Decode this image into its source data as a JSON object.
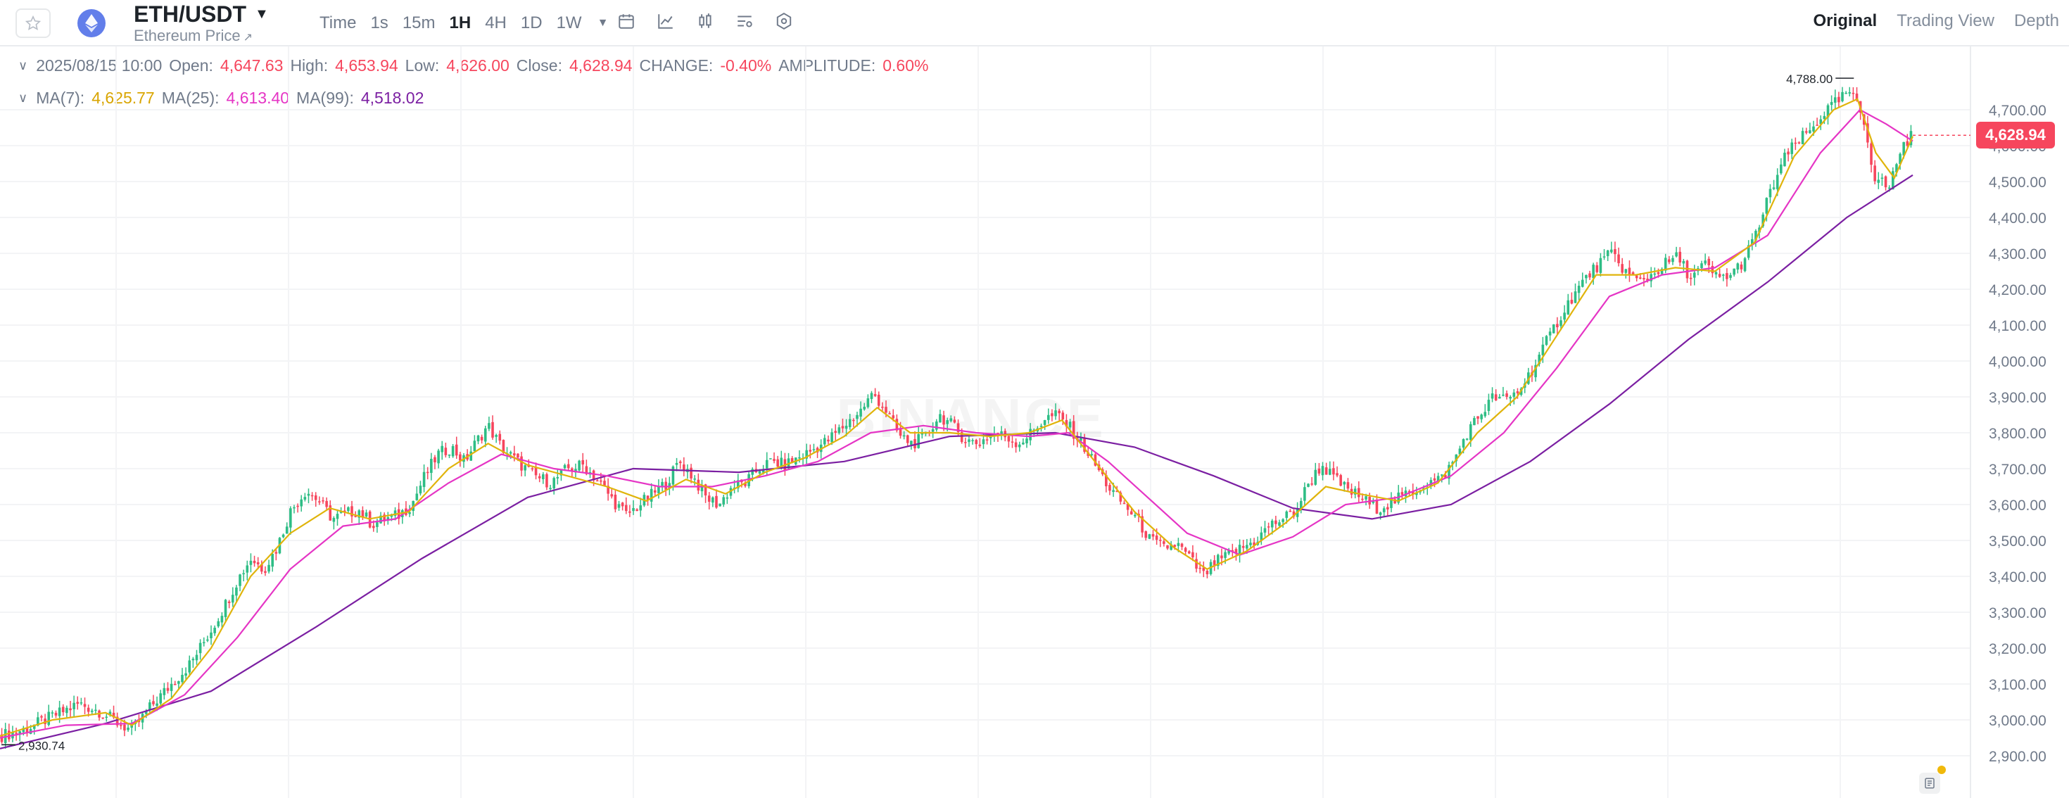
{
  "header": {
    "pair": "ETH/USDT",
    "subtitle": "Ethereum Price",
    "subtitle_arrow": "↗",
    "intervals": [
      {
        "label": "Time",
        "active": false
      },
      {
        "label": "1s",
        "active": false
      },
      {
        "label": "15m",
        "active": false
      },
      {
        "label": "1H",
        "active": true
      },
      {
        "label": "4H",
        "active": false
      },
      {
        "label": "1D",
        "active": false
      },
      {
        "label": "1W",
        "active": false
      }
    ],
    "views": [
      {
        "label": "Original",
        "active": true
      },
      {
        "label": "Trading View",
        "active": false
      },
      {
        "label": "Depth",
        "active": false
      }
    ]
  },
  "ohlc": {
    "datetime": "2025/08/15 10:00",
    "open_label": "Open:",
    "open": "4,647.63",
    "high_label": "High:",
    "high": "4,653.94",
    "low_label": "Low:",
    "low": "4,626.00",
    "close_label": "Close:",
    "close": "4,628.94",
    "change_label": "CHANGE:",
    "change": "-0.40%",
    "amplitude_label": "AMPLITUDE:",
    "amplitude": "0.60%"
  },
  "ma": {
    "ma7_label": "MA(7):",
    "ma7": "4,625.77",
    "ma25_label": "MA(25):",
    "ma25": "4,613.40",
    "ma99_label": "MA(99):",
    "ma99": "4,518.02"
  },
  "chart_data": {
    "type": "candlestick",
    "y_ticks": [
      "4,700.00",
      "4,600.00",
      "4,500.00",
      "4,400.00",
      "4,300.00",
      "4,200.00",
      "4,100.00",
      "4,000.00",
      "3,900.00",
      "3,800.00",
      "3,700.00",
      "3,600.00",
      "3,500.00",
      "3,400.00",
      "3,300.00",
      "3,200.00",
      "3,100.00",
      "3,000.00",
      "2,900.00"
    ],
    "y_tick_values": [
      4700,
      4600,
      4500,
      4400,
      4300,
      4200,
      4100,
      4000,
      3900,
      3800,
      3700,
      3600,
      3500,
      3400,
      3300,
      3200,
      3100,
      3000,
      2900
    ],
    "ylim": [
      2850,
      4810
    ],
    "current_price_label": "4,628.94",
    "current_price": 4628.94,
    "max_label": "4,788.00",
    "max_value": 4788.0,
    "min_label": "2,930.74",
    "min_value": 2930.74,
    "watermark": "BINANCE",
    "close_path": [
      [
        0,
        2955
      ],
      [
        20,
        2975
      ],
      [
        40,
        3010
      ],
      [
        60,
        3045
      ],
      [
        75,
        3025
      ],
      [
        90,
        2990
      ],
      [
        100,
        2970
      ],
      [
        115,
        3040
      ],
      [
        130,
        3100
      ],
      [
        145,
        3160
      ],
      [
        160,
        3250
      ],
      [
        172,
        3330
      ],
      [
        180,
        3390
      ],
      [
        190,
        3450
      ],
      [
        200,
        3420
      ],
      [
        210,
        3480
      ],
      [
        220,
        3580
      ],
      [
        232,
        3640
      ],
      [
        242,
        3610
      ],
      [
        252,
        3560
      ],
      [
        262,
        3575
      ],
      [
        272,
        3585
      ],
      [
        282,
        3545
      ],
      [
        292,
        3560
      ],
      [
        302,
        3570
      ],
      [
        312,
        3600
      ],
      [
        322,
        3680
      ],
      [
        332,
        3740
      ],
      [
        342,
        3760
      ],
      [
        352,
        3720
      ],
      [
        362,
        3780
      ],
      [
        370,
        3820
      ],
      [
        380,
        3760
      ],
      [
        392,
        3720
      ],
      [
        405,
        3680
      ],
      [
        418,
        3660
      ],
      [
        430,
        3700
      ],
      [
        442,
        3710
      ],
      [
        455,
        3660
      ],
      [
        465,
        3610
      ],
      [
        475,
        3570
      ],
      [
        485,
        3600
      ],
      [
        495,
        3630
      ],
      [
        505,
        3660
      ],
      [
        515,
        3720
      ],
      [
        525,
        3680
      ],
      [
        535,
        3620
      ],
      [
        545,
        3600
      ],
      [
        555,
        3650
      ],
      [
        565,
        3660
      ],
      [
        575,
        3700
      ],
      [
        585,
        3720
      ],
      [
        595,
        3710
      ],
      [
        605,
        3730
      ],
      [
        615,
        3750
      ],
      [
        628,
        3780
      ],
      [
        640,
        3820
      ],
      [
        652,
        3860
      ],
      [
        662,
        3910
      ],
      [
        672,
        3860
      ],
      [
        682,
        3790
      ],
      [
        692,
        3770
      ],
      [
        702,
        3790
      ],
      [
        712,
        3850
      ],
      [
        722,
        3820
      ],
      [
        732,
        3780
      ],
      [
        742,
        3770
      ],
      [
        752,
        3800
      ],
      [
        762,
        3790
      ],
      [
        772,
        3770
      ],
      [
        782,
        3800
      ],
      [
        792,
        3840
      ],
      [
        802,
        3850
      ],
      [
        812,
        3810
      ],
      [
        822,
        3760
      ],
      [
        832,
        3700
      ],
      [
        842,
        3640
      ],
      [
        852,
        3600
      ],
      [
        862,
        3560
      ],
      [
        872,
        3500
      ],
      [
        882,
        3480
      ],
      [
        892,
        3490
      ],
      [
        902,
        3450
      ],
      [
        912,
        3400
      ],
      [
        922,
        3440
      ],
      [
        932,
        3460
      ],
      [
        942,
        3480
      ],
      [
        952,
        3500
      ],
      [
        962,
        3540
      ],
      [
        972,
        3560
      ],
      [
        982,
        3580
      ],
      [
        992,
        3660
      ],
      [
        1002,
        3710
      ],
      [
        1012,
        3670
      ],
      [
        1022,
        3640
      ],
      [
        1032,
        3620
      ],
      [
        1042,
        3590
      ],
      [
        1052,
        3600
      ],
      [
        1062,
        3620
      ],
      [
        1072,
        3640
      ],
      [
        1082,
        3660
      ],
      [
        1092,
        3670
      ],
      [
        1102,
        3720
      ],
      [
        1112,
        3800
      ],
      [
        1122,
        3850
      ],
      [
        1132,
        3900
      ],
      [
        1142,
        3890
      ],
      [
        1152,
        3920
      ],
      [
        1162,
        3980
      ],
      [
        1172,
        4050
      ],
      [
        1182,
        4120
      ],
      [
        1192,
        4180
      ],
      [
        1202,
        4230
      ],
      [
        1212,
        4270
      ],
      [
        1222,
        4300
      ],
      [
        1232,
        4250
      ],
      [
        1242,
        4220
      ],
      [
        1252,
        4240
      ],
      [
        1262,
        4270
      ],
      [
        1272,
        4290
      ],
      [
        1282,
        4230
      ],
      [
        1292,
        4270
      ],
      [
        1302,
        4230
      ],
      [
        1312,
        4240
      ],
      [
        1322,
        4280
      ],
      [
        1332,
        4360
      ],
      [
        1342,
        4470
      ],
      [
        1352,
        4560
      ],
      [
        1362,
        4610
      ],
      [
        1372,
        4640
      ],
      [
        1382,
        4690
      ],
      [
        1392,
        4720
      ],
      [
        1402,
        4750
      ],
      [
        1410,
        4700
      ],
      [
        1416,
        4620
      ],
      [
        1420,
        4520
      ],
      [
        1426,
        4500
      ],
      [
        1432,
        4480
      ],
      [
        1438,
        4560
      ],
      [
        1444,
        4610
      ],
      [
        1450,
        4630
      ]
    ],
    "ma7_path": [
      [
        0,
        2955
      ],
      [
        40,
        3000
      ],
      [
        80,
        3020
      ],
      [
        100,
        2985
      ],
      [
        130,
        3060
      ],
      [
        160,
        3200
      ],
      [
        190,
        3400
      ],
      [
        220,
        3520
      ],
      [
        250,
        3590
      ],
      [
        280,
        3560
      ],
      [
        310,
        3580
      ],
      [
        340,
        3700
      ],
      [
        370,
        3770
      ],
      [
        400,
        3710
      ],
      [
        430,
        3680
      ],
      [
        460,
        3650
      ],
      [
        490,
        3610
      ],
      [
        520,
        3670
      ],
      [
        550,
        3630
      ],
      [
        580,
        3690
      ],
      [
        610,
        3730
      ],
      [
        640,
        3790
      ],
      [
        665,
        3870
      ],
      [
        690,
        3800
      ],
      [
        720,
        3800
      ],
      [
        750,
        3790
      ],
      [
        780,
        3800
      ],
      [
        805,
        3835
      ],
      [
        830,
        3720
      ],
      [
        860,
        3580
      ],
      [
        890,
        3480
      ],
      [
        915,
        3420
      ],
      [
        945,
        3470
      ],
      [
        975,
        3550
      ],
      [
        1005,
        3650
      ],
      [
        1030,
        3630
      ],
      [
        1060,
        3610
      ],
      [
        1090,
        3660
      ],
      [
        1120,
        3800
      ],
      [
        1150,
        3900
      ],
      [
        1180,
        4070
      ],
      [
        1210,
        4240
      ],
      [
        1240,
        4240
      ],
      [
        1270,
        4260
      ],
      [
        1300,
        4250
      ],
      [
        1330,
        4330
      ],
      [
        1360,
        4570
      ],
      [
        1390,
        4700
      ],
      [
        1408,
        4730
      ],
      [
        1422,
        4580
      ],
      [
        1436,
        4510
      ],
      [
        1450,
        4626
      ]
    ],
    "ma25_path": [
      [
        0,
        2950
      ],
      [
        50,
        2985
      ],
      [
        100,
        2990
      ],
      [
        140,
        3070
      ],
      [
        180,
        3230
      ],
      [
        220,
        3420
      ],
      [
        260,
        3540
      ],
      [
        300,
        3560
      ],
      [
        340,
        3660
      ],
      [
        380,
        3740
      ],
      [
        420,
        3700
      ],
      [
        460,
        3680
      ],
      [
        500,
        3650
      ],
      [
        540,
        3650
      ],
      [
        580,
        3680
      ],
      [
        620,
        3720
      ],
      [
        660,
        3800
      ],
      [
        700,
        3820
      ],
      [
        740,
        3800
      ],
      [
        780,
        3790
      ],
      [
        810,
        3800
      ],
      [
        840,
        3720
      ],
      [
        870,
        3620
      ],
      [
        900,
        3520
      ],
      [
        940,
        3460
      ],
      [
        980,
        3510
      ],
      [
        1020,
        3600
      ],
      [
        1060,
        3620
      ],
      [
        1100,
        3680
      ],
      [
        1140,
        3800
      ],
      [
        1180,
        3980
      ],
      [
        1220,
        4180
      ],
      [
        1260,
        4240
      ],
      [
        1300,
        4260
      ],
      [
        1340,
        4350
      ],
      [
        1380,
        4580
      ],
      [
        1410,
        4700
      ],
      [
        1430,
        4660
      ],
      [
        1450,
        4613
      ]
    ],
    "ma99_path": [
      [
        0,
        2920
      ],
      [
        80,
        2990
      ],
      [
        160,
        3080
      ],
      [
        240,
        3260
      ],
      [
        320,
        3450
      ],
      [
        400,
        3620
      ],
      [
        480,
        3700
      ],
      [
        560,
        3690
      ],
      [
        640,
        3720
      ],
      [
        720,
        3790
      ],
      [
        800,
        3800
      ],
      [
        860,
        3760
      ],
      [
        920,
        3680
      ],
      [
        980,
        3590
      ],
      [
        1040,
        3560
      ],
      [
        1100,
        3600
      ],
      [
        1160,
        3720
      ],
      [
        1220,
        3880
      ],
      [
        1280,
        4060
      ],
      [
        1340,
        4220
      ],
      [
        1400,
        4400
      ],
      [
        1450,
        4518
      ]
    ]
  }
}
